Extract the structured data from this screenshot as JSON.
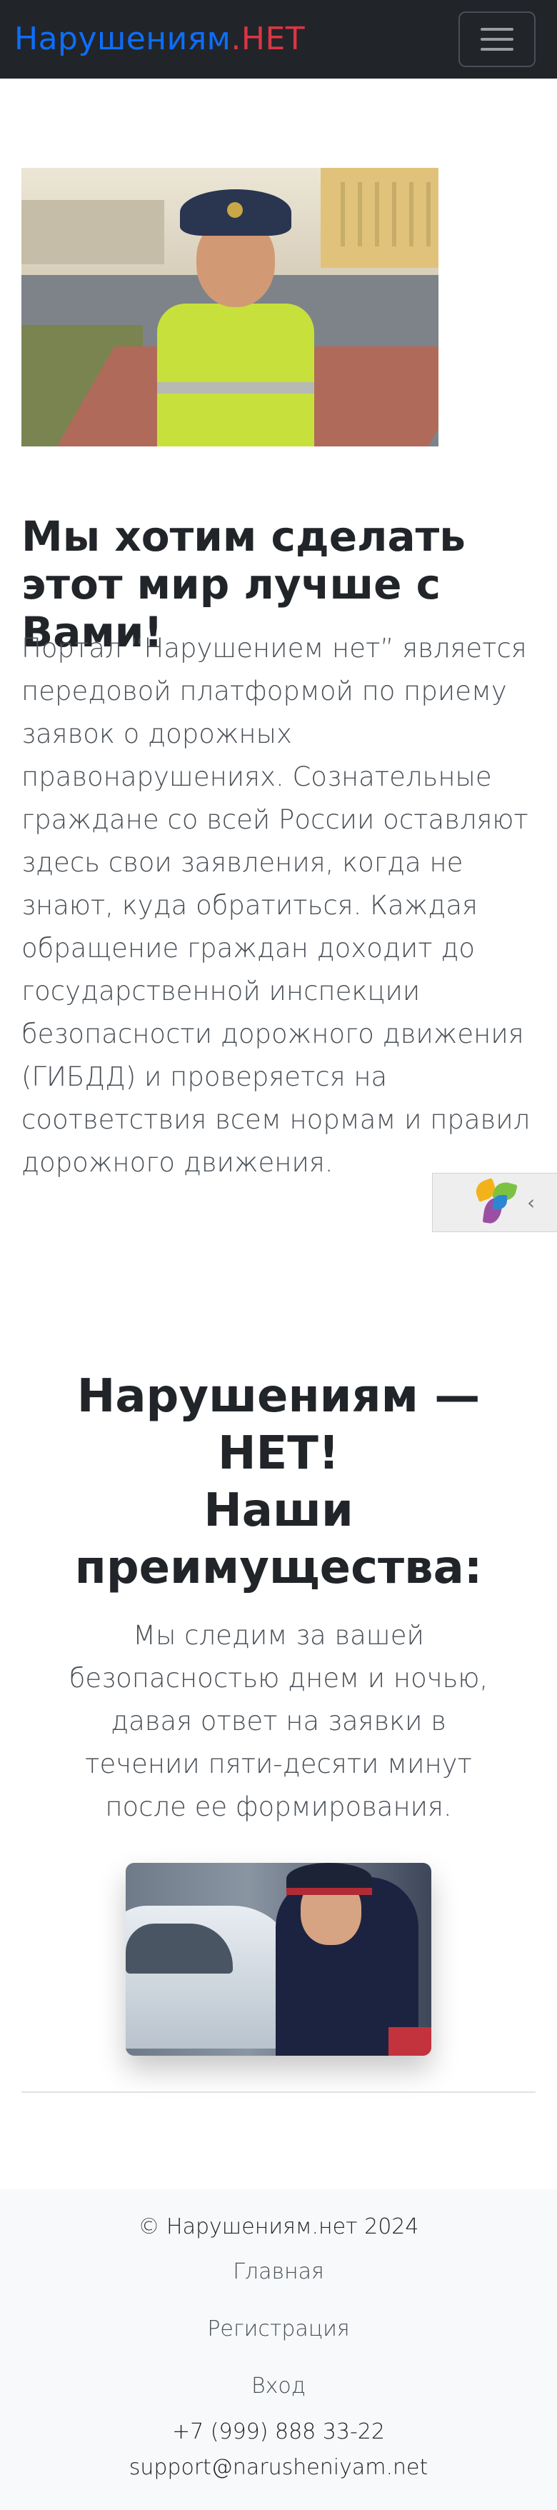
{
  "navbar": {
    "brand_part1": "Нарушениям",
    "brand_part2": ".НЕТ",
    "toggler_icon": "hamburger-menu-icon"
  },
  "hero": {
    "image_alt": "Инспектор ДПС",
    "title": "Мы хотим сделать этот мир лучше с Вами!",
    "text": "Портал “Нарушением нет” является передовой платформой по приему заявок о дорожных правонарушениях. Сознательные граждане со всей России оставляют здесь свои заявления, когда не знают, куда обратиться. Каждая обращение граждан доходит до государственной инспекции безопасности дорожного движения (ГИБДД) и проверяется на соответствия всем нормам и правил дорожного движения."
  },
  "widget": {
    "icon": "yandex-alice-leaf-icon",
    "chevron": "‹"
  },
  "features": {
    "title_line1": "Нарушениям — НЕТ!",
    "title_line2": "Наши преимущества:",
    "text": "Мы следим за вашей безопасностью днем и ночью, давая ответ на заявки в течении пяти-десяти минут после ее формирования."
  },
  "footer": {
    "copyright": "© Нарушениям.нет 2024",
    "links": [
      "Главная",
      "Регистрация",
      "Вход"
    ],
    "phone": "+7 (999) 888 33-22",
    "email": "support@narusheniyam.net"
  },
  "colors": {
    "navbar_bg": "#212529",
    "brand_blue": "#0d6efd",
    "brand_red": "#dc3545",
    "footer_bg": "#f8f9fa"
  }
}
